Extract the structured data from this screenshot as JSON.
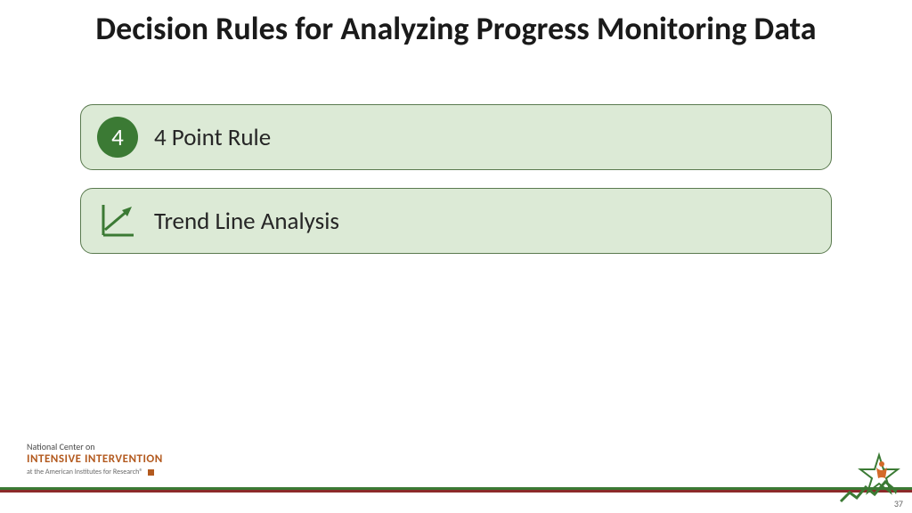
{
  "title": "Decision Rules for Analyzing Progress Monitoring Data",
  "cards": [
    {
      "badge": "4",
      "label": "4 Point Rule"
    },
    {
      "badge": "chart",
      "label": "Trend Line Analysis"
    }
  ],
  "footer": {
    "line1": "National Center on",
    "line2": "INTENSIVE INTERVENTION",
    "line3": "at the American Institutes for Research®"
  },
  "page_number": "37"
}
